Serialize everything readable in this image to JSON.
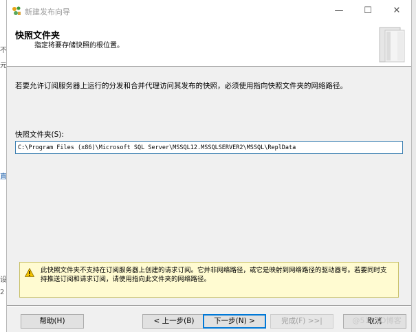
{
  "background": {
    "left_fragments": [
      "不",
      "元",
      "直",
      "设",
      "2"
    ]
  },
  "window": {
    "title": "新建发布向导",
    "controls": {
      "minimize": "—",
      "maximize": "☐",
      "close": "✕"
    }
  },
  "banner": {
    "title": "快照文件夹",
    "subtitle": "指定将要存储快照的根位置。"
  },
  "body": {
    "description": "若要允许订阅服务器上运行的分发和合并代理访问其发布的快照，必须使用指向快照文件夹的网络路径。",
    "folder_label": "快照文件夹(S):",
    "folder_value": "C:\\Program Files (x86)\\Microsoft SQL Server\\MSSQL12.MSSQLSERVER2\\MSSQL\\ReplData"
  },
  "warning": {
    "text": "此快照文件夹不支持在订阅服务器上创建的请求订阅。它并非网络路径，或它是映射到网络路径的驱动器号。若要同时支持推送订阅和请求订阅，请使用指向此文件夹的网络路径。"
  },
  "buttons": {
    "help": "帮助(H)",
    "back": "< 上一步(B)",
    "next": "下一步(N) >",
    "finish": "完成(F) >>|",
    "cancel": "取消"
  },
  "watermark": "@51CTO博客",
  "colors": {
    "accent": "#0078d7",
    "warning_bg": "#fffbd1",
    "input_border": "#3c7fb1"
  }
}
